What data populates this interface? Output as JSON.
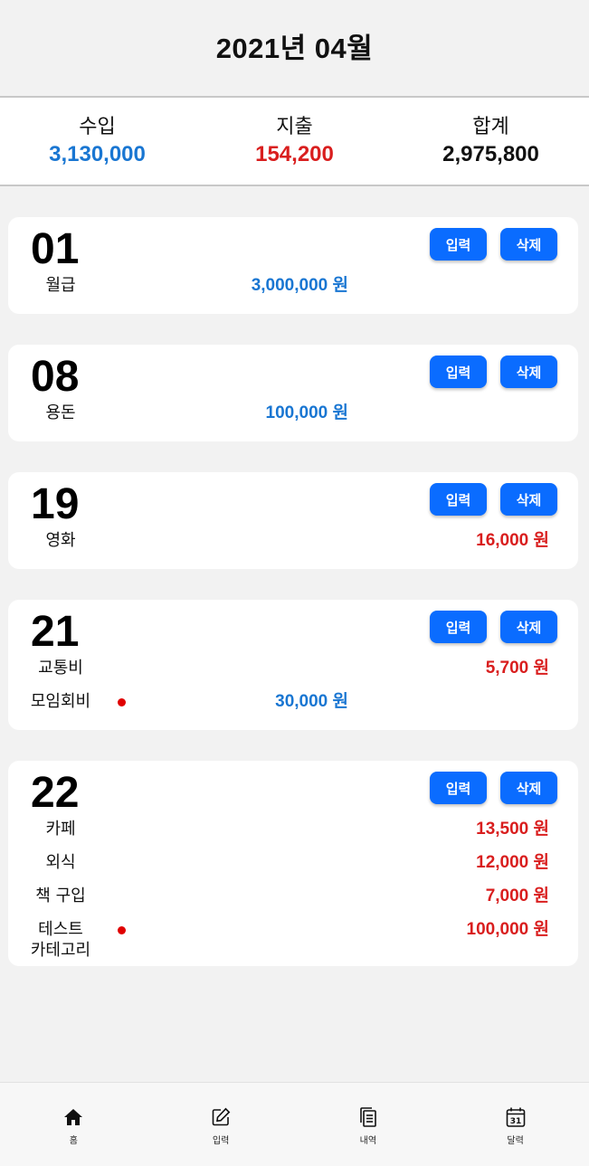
{
  "header": {
    "title": "2021년 04월"
  },
  "summary": {
    "income_label": "수입",
    "income_value": "3,130,000",
    "expense_label": "지출",
    "expense_value": "154,200",
    "total_label": "합계",
    "total_value": "2,975,800"
  },
  "buttons": {
    "input_label": "입력",
    "delete_label": "삭제"
  },
  "days": [
    {
      "day": "01",
      "entries": [
        {
          "category": "월급",
          "amount": "3,000,000 원",
          "type": "income",
          "dot": false
        }
      ]
    },
    {
      "day": "08",
      "entries": [
        {
          "category": "용돈",
          "amount": "100,000 원",
          "type": "income",
          "dot": false
        }
      ]
    },
    {
      "day": "19",
      "entries": [
        {
          "category": "영화",
          "amount": "16,000 원",
          "type": "expense",
          "dot": false
        }
      ]
    },
    {
      "day": "21",
      "entries": [
        {
          "category": "교통비",
          "amount": "5,700 원",
          "type": "expense",
          "dot": false
        },
        {
          "category": "모임회비",
          "amount": "30,000 원",
          "type": "income",
          "dot": true
        }
      ]
    },
    {
      "day": "22",
      "entries": [
        {
          "category": "카페",
          "amount": "13,500 원",
          "type": "expense",
          "dot": false
        },
        {
          "category": "외식",
          "amount": "12,000 원",
          "type": "expense",
          "dot": false
        },
        {
          "category": "책 구입",
          "amount": "7,000 원",
          "type": "expense",
          "dot": false
        },
        {
          "category": "테스트\n카테고리",
          "amount": "100,000 원",
          "type": "expense",
          "dot": true
        }
      ]
    }
  ],
  "tabs": [
    {
      "label": "홈",
      "icon": "home-icon"
    },
    {
      "label": "입력",
      "icon": "edit-icon"
    },
    {
      "label": "내역",
      "icon": "documents-icon"
    },
    {
      "label": "달력",
      "icon": "calendar-icon",
      "badge": "31"
    }
  ],
  "colors": {
    "income": "#1976d2",
    "expense": "#d91e1e",
    "button": "#0a6cff",
    "dot": "#e00000"
  }
}
